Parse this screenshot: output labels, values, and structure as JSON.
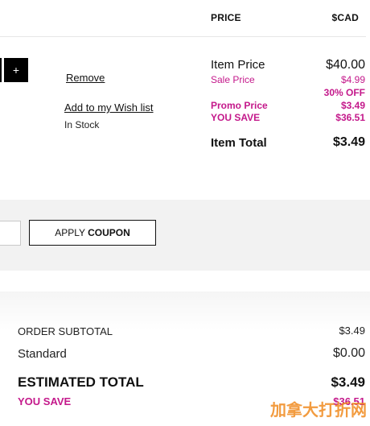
{
  "header": {
    "price": "PRICE",
    "currency": "$CAD"
  },
  "item": {
    "qty_plus": "+",
    "remove": "Remove",
    "wishlist": "Add to my Wish list",
    "stock": "In Stock",
    "item_price_label": "Item Price",
    "item_price_value": "$40.00",
    "sale_price_label": "Sale Price",
    "sale_price_value": "$4.99",
    "percent_off": "30% OFF",
    "promo_price_label": "Promo Price",
    "promo_price_value": "$3.49",
    "you_save_label": "YOU SAVE",
    "you_save_value": "$36.51",
    "item_total_label": "Item Total",
    "item_total_value": "$3.49"
  },
  "coupon": {
    "button_prefix": "APPLY ",
    "button_bold": "COUPON"
  },
  "summary": {
    "subtotal_label": "ORDER SUBTOTAL",
    "subtotal_value": "$3.49",
    "shipping_label": "Standard",
    "shipping_value": "$0.00",
    "estimated_label": "ESTIMATED TOTAL",
    "estimated_value": "$3.49",
    "you_save_label": "YOU SAVE",
    "you_save_value": "$36.51"
  },
  "watermark": "加拿大打折网",
  "colors": {
    "accent_pink": "#c4198b",
    "watermark": "#f08a1e"
  }
}
